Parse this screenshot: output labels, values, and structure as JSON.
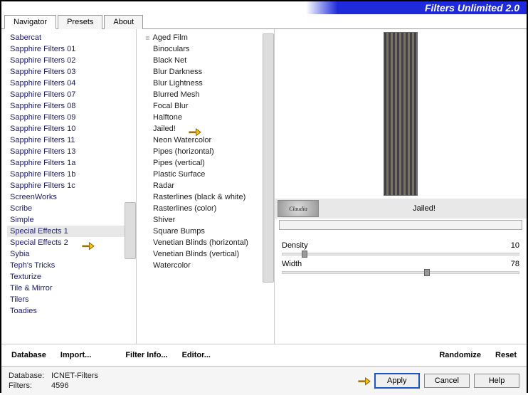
{
  "app": {
    "title": "Filters Unlimited 2.0"
  },
  "tabs": [
    {
      "label": "Navigator",
      "active": true
    },
    {
      "label": "Presets",
      "active": false
    },
    {
      "label": "About",
      "active": false
    }
  ],
  "leftList": [
    "Sabercat",
    "Sapphire Filters 01",
    "Sapphire Filters 02",
    "Sapphire Filters 03",
    "Sapphire Filters 04",
    "Sapphire Filters 07",
    "Sapphire Filters 08",
    "Sapphire Filters 09",
    "Sapphire Filters 10",
    "Sapphire Filters 11",
    "Sapphire Filters 13",
    "Sapphire Filters 1a",
    "Sapphire Filters 1b",
    "Sapphire Filters 1c",
    "ScreenWorks",
    "Scribe",
    "Simple",
    "Special Effects 1",
    "Special Effects 2",
    "Sybia",
    "Teph's Tricks",
    "Texturize",
    "Tile & Mirror",
    "Tilers",
    "Toadies"
  ],
  "leftHighlightIndex": 17,
  "midList": [
    "Aged Film",
    "Binoculars",
    "Black Net",
    "Blur Darkness",
    "Blur Lightness",
    "Blurred Mesh",
    "Focal Blur",
    "Halftone",
    "Jailed!",
    "Neon Watercolor",
    "Pipes (horizontal)",
    "Pipes (vertical)",
    "Plastic Surface",
    "Radar",
    "Rasterlines (black & white)",
    "Rasterlines (color)",
    "Shiver",
    "Square Bumps",
    "Venetian Blinds (horizontal)",
    "Venetian Blinds (vertical)",
    "Watercolor"
  ],
  "midSelectedIndex": 8,
  "preview": {
    "caption": "Jailed!",
    "watermark": "Claudia"
  },
  "params": [
    {
      "name": "Density",
      "value": 10,
      "pct": 8
    },
    {
      "name": "Width",
      "value": 78,
      "pct": 60
    }
  ],
  "toolbar": {
    "database": "Database",
    "import": "Import...",
    "filterinfo": "Filter Info...",
    "editor": "Editor...",
    "randomize": "Randomize",
    "reset": "Reset"
  },
  "footer": {
    "dbLabel": "Database:",
    "dbValue": "ICNET-Filters",
    "filtersLabel": "Filters:",
    "filtersValue": "4596",
    "apply": "Apply",
    "cancel": "Cancel",
    "help": "Help"
  }
}
